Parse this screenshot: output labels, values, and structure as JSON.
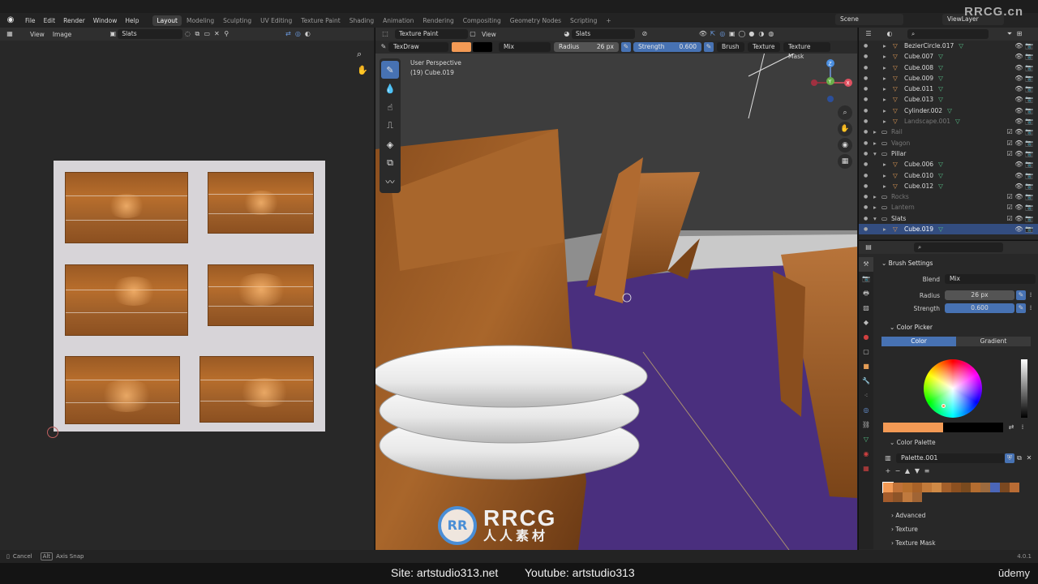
{
  "menu": {
    "items": [
      "File",
      "Edit",
      "Render",
      "Window",
      "Help"
    ],
    "workspaces": [
      "Layout",
      "Modeling",
      "Sculpting",
      "UV Editing",
      "Texture Paint",
      "Shading",
      "Animation",
      "Rendering",
      "Compositing",
      "Geometry Nodes",
      "Scripting"
    ],
    "active_workspace": "Layout",
    "add_tab": "+",
    "scene": "Scene",
    "view_layer": "ViewLayer"
  },
  "image_editor": {
    "view_label": "View",
    "image_label": "Image",
    "image_name": "Slats"
  },
  "viewport": {
    "mode": "Texture Paint",
    "view_label": "View",
    "image_name": "Slats",
    "brush_name": "TexDraw",
    "blend": "Mix",
    "radius_label": "Radius",
    "radius_value": "26 px",
    "strength_label": "Strength",
    "strength_value": "0.600",
    "brush_menu": "Brush",
    "texture_menu": "Texture",
    "texture_mask_menu": "Texture Mask",
    "perspective": "User Perspective",
    "active_object": "(19) Cube.019",
    "primary_color": "#f39a55",
    "secondary_color": "#000000",
    "axes": {
      "x": "X",
      "y": "Y",
      "z": "Z"
    }
  },
  "outliner": {
    "rows": [
      {
        "name": "BezierCircle.017",
        "type": "object",
        "dim": false,
        "selected": false
      },
      {
        "name": "Cube.007",
        "type": "object",
        "dim": false,
        "selected": false
      },
      {
        "name": "Cube.008",
        "type": "object",
        "dim": false,
        "selected": false
      },
      {
        "name": "Cube.009",
        "type": "object",
        "dim": false,
        "selected": false
      },
      {
        "name": "Cube.011",
        "type": "object",
        "dim": false,
        "selected": false
      },
      {
        "name": "Cube.013",
        "type": "object",
        "dim": false,
        "selected": false
      },
      {
        "name": "Cylinder.002",
        "type": "object",
        "dim": false,
        "selected": false
      },
      {
        "name": "Landscape.001",
        "type": "object",
        "dim": true,
        "selected": false
      },
      {
        "name": "Rail",
        "type": "collection",
        "dim": true,
        "selected": false
      },
      {
        "name": "Vagon",
        "type": "collection",
        "dim": true,
        "selected": false
      },
      {
        "name": "Pillar",
        "type": "collection",
        "dim": false,
        "selected": false
      },
      {
        "name": "Cube.006",
        "type": "object",
        "dim": false,
        "selected": false
      },
      {
        "name": "Cube.010",
        "type": "object",
        "dim": false,
        "selected": false
      },
      {
        "name": "Cube.012",
        "type": "object",
        "dim": false,
        "selected": false
      },
      {
        "name": "Rocks",
        "type": "collection",
        "dim": true,
        "selected": false
      },
      {
        "name": "Lantern",
        "type": "collection",
        "dim": true,
        "selected": false
      },
      {
        "name": "Slats",
        "type": "collection",
        "dim": false,
        "selected": false
      },
      {
        "name": "Cube.019",
        "type": "object",
        "dim": false,
        "selected": true
      }
    ]
  },
  "properties": {
    "brush_settings": "Brush Settings",
    "blend_label": "Blend",
    "blend_value": "Mix",
    "radius_label": "Radius",
    "radius_value": "26 px",
    "strength_label": "Strength",
    "strength_value": "0.600",
    "color_picker": "Color Picker",
    "tab_color": "Color",
    "tab_gradient": "Gradient",
    "primary_color": "#f39a55",
    "secondary_color": "#000000",
    "color_palette": "Color Palette",
    "palette_name": "Palette.001",
    "palette_colors": [
      "#f39a55",
      "#c07238",
      "#b8702e",
      "#a86228",
      "#c27a3a",
      "#d08a46",
      "#a35f2a",
      "#8c5020",
      "#7a4a1e",
      "#b46d30",
      "#9c6a3e",
      "#4b66b8",
      "#7a4820",
      "#b96c34",
      "#a45c2c",
      "#8e5428",
      "#c07a3e",
      "#a06434"
    ],
    "advanced": "Advanced",
    "texture": "Texture",
    "texture_mask": "Texture Mask"
  },
  "status": {
    "cancel": "Cancel",
    "alt": "Alt",
    "axis_snap": "Axis Snap",
    "version": "4.0.1"
  },
  "captions": {
    "site": "Site: artstudio313.net",
    "youtube": "Youtube: artstudio313",
    "udemy": "ūdemy",
    "watermark_top": "RRCG.cn",
    "watermark_big": "RRCG",
    "watermark_small": "人人素材",
    "watermark_logo": "RR"
  }
}
